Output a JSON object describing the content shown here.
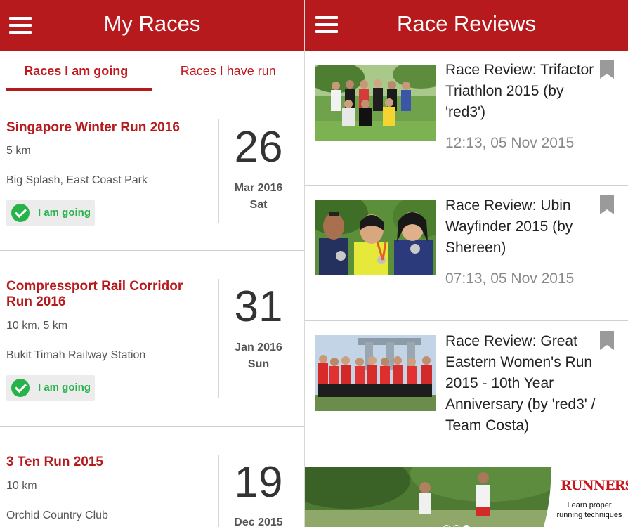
{
  "my_races": {
    "title": "My Races",
    "tabs": [
      {
        "label": "Races I am going"
      },
      {
        "label": "Races I have run"
      }
    ],
    "races": [
      {
        "title": "Singapore Winter Run 2016",
        "distance": "5 km",
        "venue": "Big Splash, East Coast Park",
        "status": "I am going",
        "day": "26",
        "month": "Mar 2016",
        "weekday": "Sat"
      },
      {
        "title": "Compressport Rail Corridor Run 2016",
        "distance": "10 km, 5 km",
        "venue": "Bukit Timah Railway Station",
        "status": "I am going",
        "day": "31",
        "month": "Jan 2016",
        "weekday": "Sun"
      },
      {
        "title": "3 Ten Run 2015",
        "distance": "10 km",
        "venue": "Orchid Country Club",
        "day": "19",
        "month": "Dec 2015"
      }
    ]
  },
  "race_reviews": {
    "title": "Race Reviews",
    "reviews": [
      {
        "title": "Race Review: Trifactor Triathlon 2015 (by 'red3')",
        "time": "12:13, 05 Nov 2015"
      },
      {
        "title": "Race Review: Ubin Wayfinder 2015 (by Shereen)",
        "time": "07:13, 05 Nov 2015"
      },
      {
        "title": "Race Review: Great Eastern Women's Run 2015 - 10th Year Anniversary (by 'red3' / Team Costa)"
      }
    ],
    "banner": {
      "logo": "RUNNERS",
      "text_line1": "Learn proper",
      "text_line2": "running techniques",
      "slide_count": 3,
      "active_slide": 3
    }
  },
  "colors": {
    "brand_red": "#b71a1c",
    "going_green": "#27b34a"
  }
}
